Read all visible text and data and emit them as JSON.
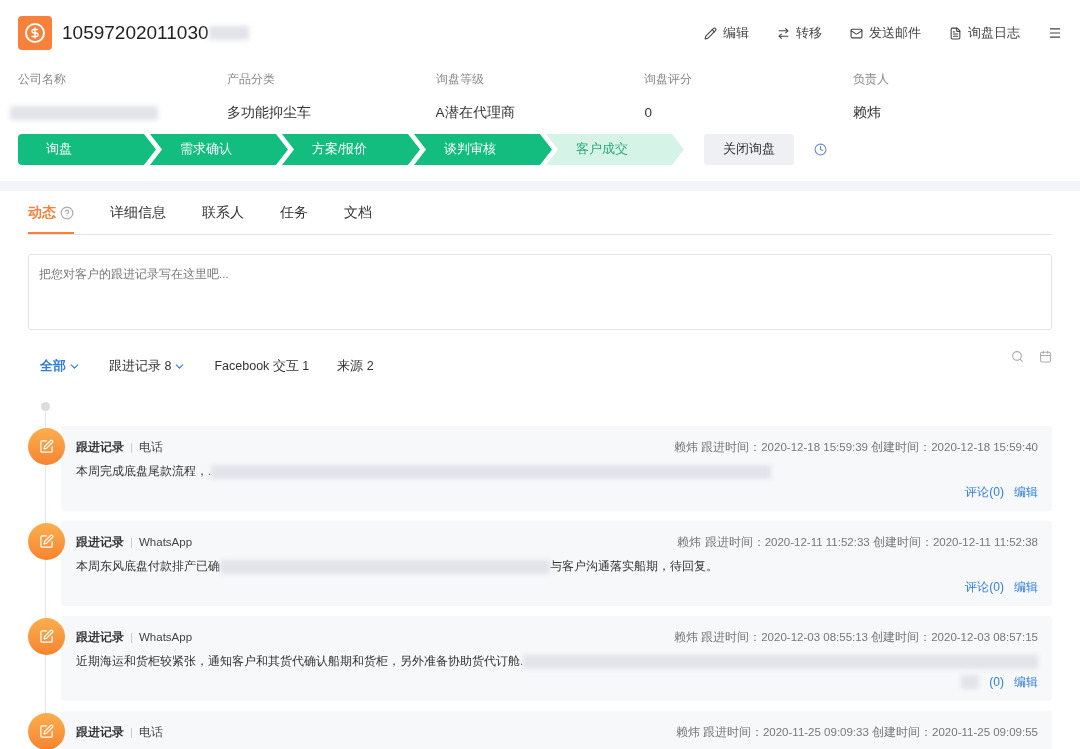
{
  "header": {
    "title": "10597202011030",
    "actions": [
      {
        "kind": "edit",
        "label": "编辑"
      },
      {
        "kind": "transfer",
        "label": "转移"
      },
      {
        "kind": "mail",
        "label": "发送邮件"
      },
      {
        "kind": "log",
        "label": "询盘日志"
      }
    ]
  },
  "fields": [
    {
      "label": "公司名称"
    },
    {
      "label": "产品分类",
      "value": "多功能抑尘车"
    },
    {
      "label": "询盘等级",
      "value": "A潜在代理商"
    },
    {
      "label": "询盘评分",
      "value": "0"
    },
    {
      "label": "负责人",
      "value": "赖炜"
    }
  ],
  "stages": [
    {
      "label": "询盘",
      "done": true
    },
    {
      "label": "需求确认",
      "done": true
    },
    {
      "label": "方案/报价",
      "done": true
    },
    {
      "label": "谈判审核",
      "done": true
    },
    {
      "label": "客户成交",
      "done": false
    }
  ],
  "close_button": "关闭询盘",
  "tabs": [
    {
      "label": "动态",
      "selected": true,
      "help": true
    },
    {
      "label": "详细信息",
      "selected": false
    },
    {
      "label": "联系人",
      "selected": false
    },
    {
      "label": "任务",
      "selected": false
    },
    {
      "label": "文档",
      "selected": false
    }
  ],
  "note": {
    "placeholder": "把您对客户的跟进记录写在这里吧..."
  },
  "filters": [
    {
      "label": "全部",
      "selected": true,
      "dropdown": true
    },
    {
      "label": "跟进记录 8",
      "selected": false,
      "dropdown": true
    },
    {
      "label": "Facebook 交互 1",
      "selected": false,
      "dropdown": false
    },
    {
      "label": "来源 2",
      "selected": false,
      "dropdown": false
    }
  ],
  "records": [
    {
      "type": "跟进记录",
      "channel": "电话",
      "meta": "赖炜 跟进时间：2020-12-18 15:59:39 创建时间：2020-12-18 15:59:40",
      "text": "本周完成底盘尾款流程，.",
      "comment": "评论(0)",
      "edit": "编辑"
    },
    {
      "type": "跟进记录",
      "channel": "WhatsApp",
      "meta": "赖炜 跟进时间：2020-12-11 11:52:33 创建时间：2020-12-11 11:52:38",
      "text": "本周东风底盘付款排产已确",
      "text_after": "与客户沟通落实船期，待回复。",
      "comment": "评论(0)",
      "edit": "编辑"
    },
    {
      "type": "跟进记录",
      "channel": "WhatsApp",
      "meta": "赖炜 跟进时间：2020-12-03 08:55:13 创建时间：2020-12-03 08:57:15",
      "text": "近期海运和货柜较紧张，通知客户和其货代确认船期和货柜，另外准备协助货代订舱.",
      "comment": "(0)",
      "edit": "编辑"
    },
    {
      "type": "跟进记录",
      "channel": "电话",
      "meta": "赖炜 跟进时间：2020-11-25 09:09:33 创建时间：2020-11-25 09:09:55"
    }
  ]
}
